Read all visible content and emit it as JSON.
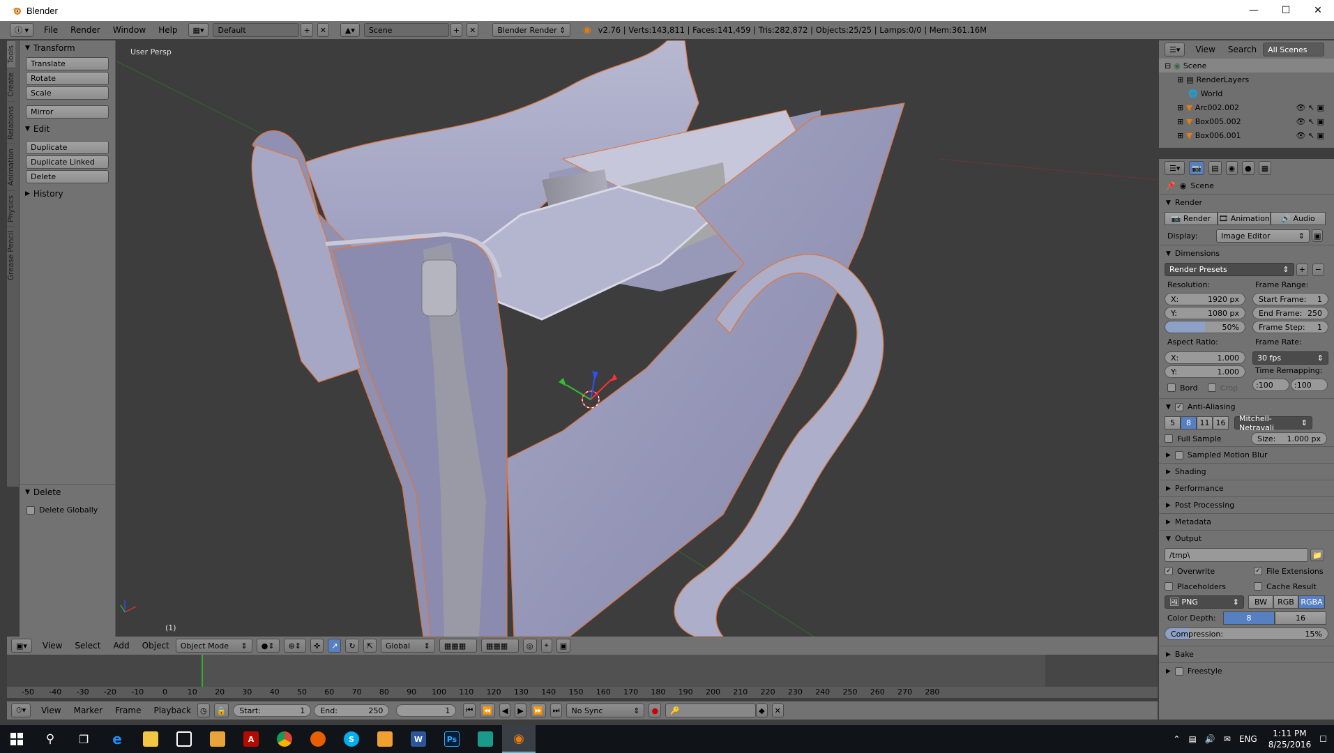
{
  "window": {
    "title": "Blender"
  },
  "info_header": {
    "menus": [
      "File",
      "Render",
      "Window",
      "Help"
    ],
    "layout": "Default",
    "scene": "Scene",
    "engine": "Blender Render",
    "stats": "v2.76 | Verts:143,811 | Faces:141,459 | Tris:282,872 | Objects:25/25 | Lamps:0/0 | Mem:361.16M"
  },
  "left_tabs": [
    "Tools",
    "Create",
    "Relations",
    "Animation",
    "Physics",
    "Grease Pencil"
  ],
  "tool_shelf": {
    "transform_title": "Transform",
    "transform_buttons": [
      "Translate",
      "Rotate",
      "Scale",
      "Mirror"
    ],
    "edit_title": "Edit",
    "edit_buttons": [
      "Duplicate",
      "Duplicate Linked",
      "Delete"
    ],
    "history_title": "History",
    "operator_title": "Delete",
    "operator_option": "Delete Globally"
  },
  "viewport": {
    "view_label": "User Persp",
    "frame_label": "(1)"
  },
  "vp_header": {
    "menus": [
      "View",
      "Select",
      "Add",
      "Object"
    ],
    "mode": "Object Mode",
    "orientation": "Global"
  },
  "timeline": {
    "ticks": [
      "-50",
      "-40",
      "-30",
      "-20",
      "-10",
      "0",
      "10",
      "20",
      "30",
      "40",
      "50",
      "60",
      "70",
      "80",
      "90",
      "100",
      "110",
      "120",
      "130",
      "140",
      "150",
      "160",
      "170",
      "180",
      "190",
      "200",
      "210",
      "220",
      "230",
      "240",
      "250",
      "260",
      "270",
      "280"
    ],
    "menus": [
      "View",
      "Marker",
      "Frame",
      "Playback"
    ],
    "start_label": "Start:",
    "start_value": "1",
    "end_label": "End:",
    "end_value": "250",
    "current": "1",
    "sync": "No Sync"
  },
  "outliner": {
    "menus": [
      "View",
      "Search"
    ],
    "filter": "All Scenes",
    "rows": [
      "Scene",
      "RenderLayers",
      "World",
      "Arc002.002",
      "Box005.002",
      "Box006.001"
    ]
  },
  "properties": {
    "context": "Scene",
    "render_title": "Render",
    "render_buttons": [
      "Render",
      "Animation",
      "Audio"
    ],
    "display_label": "Display:",
    "display_value": "Image Editor",
    "dimensions_title": "Dimensions",
    "presets": "Render Presets",
    "resolution_label": "Resolution:",
    "res_x_label": "X:",
    "res_x": "1920 px",
    "res_y_label": "Y:",
    "res_y": "1080 px",
    "res_pct": "50%",
    "frame_range_label": "Frame Range:",
    "start_frame_label": "Start Frame:",
    "start_frame": "1",
    "end_frame_label": "End Frame:",
    "end_frame": "250",
    "frame_step_label": "Frame Step:",
    "frame_step": "1",
    "aspect_label": "Aspect Ratio:",
    "asp_x_label": "X:",
    "asp_x": "1.000",
    "asp_y_label": "Y:",
    "asp_y": "1.000",
    "frame_rate_label": "Frame Rate:",
    "frame_rate": "30 fps",
    "time_remap_label": "Time Remapping:",
    "remap_old": ":100",
    "remap_new": ":100",
    "bord": "Bord",
    "crop": "Crop",
    "aa_title": "Anti-Aliasing",
    "aa_samples": [
      "5",
      "8",
      "11",
      "16"
    ],
    "aa_filter": "Mitchell-Netravali",
    "full_sample": "Full Sample",
    "size_label": "Size:",
    "size_value": "1.000 px",
    "collapsed": [
      "Sampled Motion Blur",
      "Shading",
      "Performance",
      "Post Processing",
      "Metadata"
    ],
    "output_title": "Output",
    "output_path": "/tmp\\",
    "overwrite": "Overwrite",
    "file_ext": "File Extensions",
    "placeholders": "Placeholders",
    "cache_result": "Cache Result",
    "format": "PNG",
    "color_modes": [
      "BW",
      "RGB",
      "RGBA"
    ],
    "color_depth_label": "Color Depth:",
    "depths": [
      "8",
      "16"
    ],
    "compression_label": "Compression:",
    "compression": "15%",
    "bake": "Bake",
    "freestyle": "Freestyle"
  },
  "taskbar": {
    "lang": "ENG",
    "time": "1:11 PM",
    "date": "8/25/2016"
  }
}
